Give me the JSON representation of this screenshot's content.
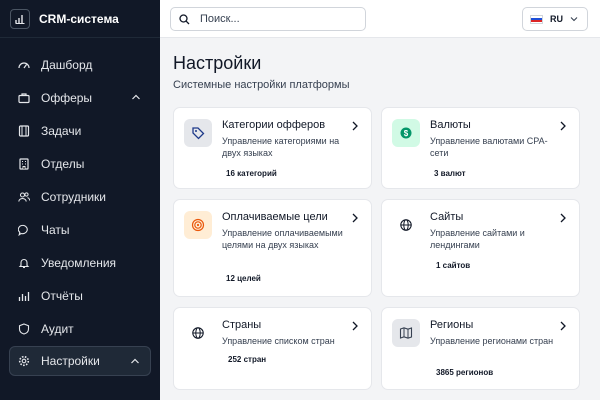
{
  "app": {
    "title": "CRM-система"
  },
  "sidebar": {
    "items": [
      {
        "label": "Дашборд",
        "icon": "dashboard-icon"
      },
      {
        "label": "Офферы",
        "icon": "briefcase-icon"
      },
      {
        "label": "Задачи",
        "icon": "tasks-icon"
      },
      {
        "label": "Отделы",
        "icon": "building-icon"
      },
      {
        "label": "Сотрудники",
        "icon": "users-icon"
      },
      {
        "label": "Чаты",
        "icon": "chat-icon"
      },
      {
        "label": "Уведомления",
        "icon": "bell-icon"
      },
      {
        "label": "Отчёты",
        "icon": "reports-icon"
      },
      {
        "label": "Аудит",
        "icon": "shield-icon"
      },
      {
        "label": "Настройки",
        "icon": "gear-icon",
        "active": true
      }
    ]
  },
  "topbar": {
    "search_placeholder": "Поиск...",
    "language": "RU"
  },
  "page": {
    "title": "Настройки",
    "subtitle": "Системные настройки платформы"
  },
  "cards": [
    {
      "title": "Категории офферов",
      "description": "Управление категориями на двух языках",
      "badge": "16 категорий",
      "icon": "tag-icon"
    },
    {
      "title": "Валюты",
      "description": "Управление валютами CPA-сети",
      "badge": "3 валют",
      "icon": "currency-icon"
    },
    {
      "title": "Оплачиваемые цели",
      "description": "Управление оплачиваемыми целями на двух языках",
      "badge": "12 целей",
      "icon": "target-icon"
    },
    {
      "title": "Сайты",
      "description": "Управление сайтами и лендингами",
      "badge": "1 сайтов",
      "icon": "globe-icon"
    },
    {
      "title": "Страны",
      "description": "Управление списком стран",
      "badge": "252 стран",
      "icon": "globe-icon"
    },
    {
      "title": "Регионы",
      "description": "Управление регионами стран",
      "badge": "3865 регионов",
      "icon": "map-icon"
    }
  ],
  "colors": {
    "sidebar_bg": "#111827",
    "accent_green": "#059669",
    "accent_orange": "#ea580c"
  }
}
